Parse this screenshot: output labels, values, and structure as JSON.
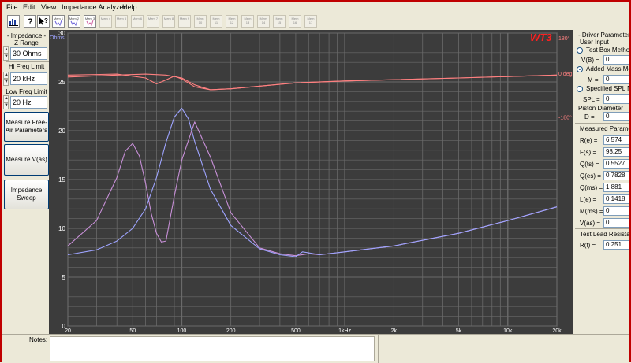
{
  "menu": {
    "items": [
      "File",
      "Edit",
      "View",
      "Impedance Analyzer",
      "Help"
    ]
  },
  "toolbar": {
    "buttons": [
      {
        "icon": "chart-icon",
        "label": ""
      },
      {
        "icon": "help-pointer-icon",
        "label": ""
      },
      {
        "icon": "context-help-icon",
        "label": ""
      },
      {
        "icon": "memory-slot-icon",
        "label": "Mem 1",
        "active": true
      },
      {
        "icon": "memory-slot-icon",
        "label": "Mem 2",
        "active": true
      },
      {
        "icon": "memory-slot-icon",
        "label": "Mem 3",
        "active": true
      },
      {
        "icon": "memory-slot-icon",
        "label": "Mem 4"
      },
      {
        "icon": "memory-slot-icon",
        "label": "Mem 5"
      },
      {
        "icon": "memory-slot-icon",
        "label": "Mem 6"
      },
      {
        "icon": "memory-slot-icon",
        "label": "Mem 7"
      },
      {
        "icon": "memory-slot-icon",
        "label": "Mem 8"
      },
      {
        "icon": "memory-slot-icon",
        "label": "Mem 9"
      },
      {
        "icon": "memory-slot-icon",
        "label": "Mem 10"
      },
      {
        "icon": "memory-slot-icon",
        "label": "Mem 11"
      },
      {
        "icon": "memory-slot-icon",
        "label": "Mem 12"
      },
      {
        "icon": "memory-slot-icon",
        "label": "Mem 13"
      },
      {
        "icon": "memory-slot-icon",
        "label": "Mem 14"
      },
      {
        "icon": "memory-slot-icon",
        "label": "Mem 15"
      },
      {
        "icon": "memory-slot-icon",
        "label": "Mem 16"
      },
      {
        "icon": "memory-slot-icon",
        "label": "Mem 17"
      }
    ]
  },
  "left_panel": {
    "impedance_title": "- Impedance -",
    "z_range_label": "Z Range",
    "z_range_value": "30 Ohms",
    "hi_freq_label": "Hi Freq Limit",
    "hi_freq_value": "20 kHz",
    "low_freq_label": "Low Freq Limit",
    "low_freq_value": "20 Hz",
    "measure_free_air_label": "Measure Free-Air Parameters",
    "measure_vas_label": "Measure V(as)",
    "impedance_sweep_label": "Impedance Sweep"
  },
  "graph": {
    "logo": "WT3",
    "y_unit": "Ohms",
    "y_ticks": [
      "30",
      "25",
      "20",
      "15",
      "10",
      "5",
      "0"
    ],
    "phase_ticks": [
      "180°",
      "0 deg",
      "-180°"
    ],
    "x_ticks": [
      "20",
      "50",
      "100",
      "200",
      "500",
      "1kHz",
      "2k",
      "5k",
      "10k",
      "20k"
    ],
    "colors": {
      "background": "#3c3c3c",
      "grid": "#6a6a6a",
      "impedance_trace": "#9ea4ff",
      "phase_trace": "#ff8080",
      "logo": "#ff2020",
      "ohms_label": "#9ea4ff",
      "phase_label": "#ff8080"
    }
  },
  "chart_data": {
    "type": "line",
    "title": "",
    "xlabel": "",
    "ylabel": "Ohms",
    "x_scale": "log",
    "xlim": [
      20,
      20000
    ],
    "ylim": [
      0,
      30
    ],
    "y2_range_deg": [
      -180,
      180
    ],
    "grid": true,
    "series": [
      {
        "key": "trace_a_impedance",
        "role": "impedance",
        "x": [
          20,
          30,
          40,
          45,
          50,
          55,
          60,
          65,
          70,
          75,
          80,
          90,
          100,
          120,
          150,
          200,
          300,
          400,
          500,
          600,
          700,
          1000,
          2000,
          5000,
          10000,
          20000
        ],
        "y": [
          8.2,
          10.8,
          15.2,
          17.9,
          18.7,
          17.4,
          14.6,
          11.5,
          9.5,
          8.6,
          8.7,
          13.3,
          17.0,
          20.9,
          17.3,
          11.6,
          8.0,
          7.4,
          7.2,
          7.4,
          7.3,
          7.6,
          8.2,
          9.5,
          10.8,
          12.2
        ]
      },
      {
        "key": "trace_b_impedance",
        "role": "impedance",
        "x": [
          20,
          30,
          40,
          50,
          60,
          70,
          80,
          90,
          100,
          110,
          120,
          150,
          200,
          300,
          400,
          500,
          550,
          600,
          700,
          1000,
          2000,
          5000,
          10000,
          20000
        ],
        "y": [
          7.3,
          7.8,
          8.7,
          10.0,
          12.0,
          15.2,
          18.8,
          21.4,
          22.3,
          21.2,
          18.9,
          14.0,
          10.3,
          7.9,
          7.3,
          7.1,
          7.6,
          7.5,
          7.3,
          7.6,
          8.2,
          9.5,
          10.8,
          12.2
        ]
      },
      {
        "key": "trace_a_phase",
        "role": "phase",
        "x": [
          20,
          40,
          60,
          70,
          80,
          90,
          100,
          120,
          150,
          200,
          500,
          1000,
          5000,
          20000
        ],
        "y": [
          25.7,
          25.8,
          25.4,
          24.8,
          25.2,
          25.6,
          25.3,
          24.5,
          24.2,
          24.3,
          24.9,
          25.1,
          25.4,
          25.7
        ]
      },
      {
        "key": "trace_b_phase",
        "role": "phase",
        "x": [
          20,
          40,
          60,
          80,
          100,
          120,
          150,
          200,
          500,
          1000,
          5000,
          20000
        ],
        "y": [
          25.5,
          25.7,
          25.8,
          25.7,
          25.4,
          24.7,
          24.2,
          24.3,
          24.9,
          25.1,
          25.4,
          25.7
        ]
      }
    ]
  },
  "right_panel": {
    "title": "- Driver Parameters -",
    "user_input_title": "User Input",
    "test_box_label": "Test Box Method",
    "vb_label": "V(B) =",
    "vb_value": "0",
    "added_mass_label": "Added Mass Method",
    "m_label": "M =",
    "m_value": "0",
    "specified_spl_label": "Specified SPL Method",
    "spl_label": "SPL =",
    "spl_value": "0",
    "piston_label": "Piston Diameter",
    "d_label": "D =",
    "d_value": "0",
    "measured_title": "Measured Parameters",
    "params": [
      {
        "label": "R(e) =",
        "value": "6.574"
      },
      {
        "label": "F(s) =",
        "value": "98.25"
      },
      {
        "label": "Q(ts) =",
        "value": "0.5527"
      },
      {
        "label": "Q(es) =",
        "value": "0.7828"
      },
      {
        "label": "Q(ms) =",
        "value": "1.881"
      },
      {
        "label": "L(e) =",
        "value": "0.1418"
      },
      {
        "label": "M(ms) =",
        "value": "0"
      },
      {
        "label": "V(as) =",
        "value": "0"
      }
    ],
    "test_lead_title": "Test Lead Resistance",
    "rt_label": "R(t) =",
    "rt_value": "0.251"
  },
  "notes": {
    "label": "Notes:",
    "value": ""
  }
}
